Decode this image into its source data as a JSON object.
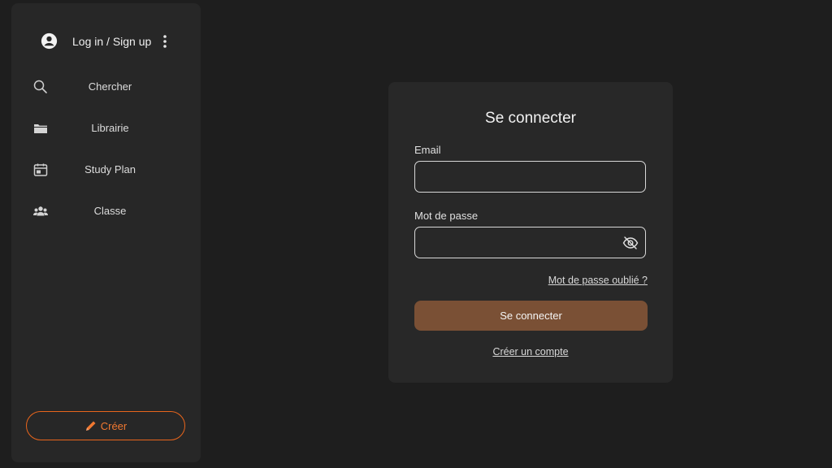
{
  "sidebar": {
    "account": {
      "label": "Log in / Sign up",
      "icon": "user-circle-icon",
      "more_icon": "more-vertical-icon"
    },
    "items": [
      {
        "label": "Chercher",
        "icon": "search-icon"
      },
      {
        "label": "Librairie",
        "icon": "folder-icon"
      },
      {
        "label": "Study Plan",
        "icon": "calendar-icon"
      },
      {
        "label": "Classe",
        "icon": "group-icon"
      }
    ],
    "create_button": {
      "label": "Créer",
      "icon": "pencil-icon",
      "color": "#e8651c"
    }
  },
  "login": {
    "title": "Se connecter",
    "email_label": "Email",
    "email_value": "",
    "password_label": "Mot de passe",
    "password_value": "",
    "password_toggle_icon": "eye-off-icon",
    "forgot_link": "Mot de passe oublié ?",
    "submit_label": "Se connecter",
    "submit_color": "#7a5035",
    "signup_link": "Créer un compte"
  },
  "colors": {
    "background": "#1e1e1e",
    "panel": "#272727",
    "accent": "#e8651c"
  }
}
